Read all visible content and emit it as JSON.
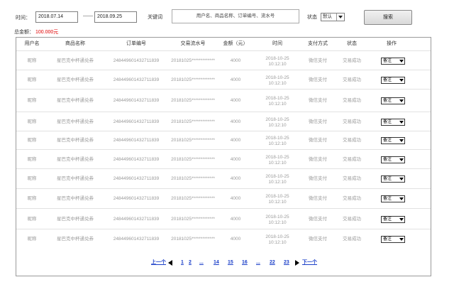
{
  "filters": {
    "time_label": "时间：",
    "start_date": "2018.07.14",
    "dash": "——",
    "end_date": "2018.09.25",
    "keyword_label": "关键词",
    "keyword_placeholder": "用户名、商品名称、订单编号、流水号",
    "status_label": "状态",
    "status_value": "默认",
    "search_button": "搜索"
  },
  "summary": {
    "total_label": "总金额：",
    "total_value": "100.000元",
    "total_color": "#e00000"
  },
  "table": {
    "headers": [
      "用户名",
      "商品名称",
      "订单编号",
      "交易流水号",
      "金额（元）",
      "时间",
      "支付方式",
      "状态",
      "操作"
    ],
    "rows": [
      {
        "user": "昵称",
        "product": "星巴克中杯通兑券",
        "order": "248449601432711839",
        "serial": "20181025*************",
        "amount": "4000",
        "date": "2018-10-25",
        "time": "10:12:10",
        "pay": "微信支付",
        "status": "交易成功",
        "op": "备注"
      },
      {
        "user": "昵称",
        "product": "星巴克中杯通兑券",
        "order": "248449601432711839",
        "serial": "20181025*************",
        "amount": "4000",
        "date": "2018-10-25",
        "time": "10:12:10",
        "pay": "微信支付",
        "status": "交易成功",
        "op": "备注"
      },
      {
        "user": "昵称",
        "product": "星巴克中杯通兑券",
        "order": "248449601432711839",
        "serial": "20181025*************",
        "amount": "4000",
        "date": "2018-10-25",
        "time": "10:12:10",
        "pay": "微信支付",
        "status": "交易成功",
        "op": "备注"
      },
      {
        "user": "昵称",
        "product": "星巴克中杯通兑券",
        "order": "248449601432711839",
        "serial": "20181025*************",
        "amount": "4000",
        "date": "2018-10-25",
        "time": "10:12:10",
        "pay": "微信支付",
        "status": "交易成功",
        "op": "备注"
      },
      {
        "user": "昵称",
        "product": "星巴克中杯通兑券",
        "order": "248449601432711839",
        "serial": "20181025*************",
        "amount": "4000",
        "date": "2018-10-25",
        "time": "10:12:10",
        "pay": "微信支付",
        "status": "交易成功",
        "op": "备注"
      },
      {
        "user": "昵称",
        "product": "星巴克中杯通兑券",
        "order": "248449601432711839",
        "serial": "20181025*************",
        "amount": "4000",
        "date": "2018-10-25",
        "time": "10:12:10",
        "pay": "微信支付",
        "status": "交易成功",
        "op": "备注"
      },
      {
        "user": "昵称",
        "product": "星巴克中杯通兑券",
        "order": "248449601432711839",
        "serial": "20181025*************",
        "amount": "4000",
        "date": "2018-10-25",
        "time": "10:12:10",
        "pay": "微信支付",
        "status": "交易成功",
        "op": "备注"
      },
      {
        "user": "昵称",
        "product": "星巴克中杯通兑券",
        "order": "248449601432711839",
        "serial": "20181025*************",
        "amount": "4000",
        "date": "2018-10-25",
        "time": "10:12:10",
        "pay": "微信支付",
        "status": "交易成功",
        "op": "备注"
      },
      {
        "user": "昵称",
        "product": "星巴克中杯通兑券",
        "order": "248449601432711839",
        "serial": "20181025*************",
        "amount": "4000",
        "date": "2018-10-25",
        "time": "10:12:10",
        "pay": "微信支付",
        "status": "交易成功",
        "op": "备注"
      },
      {
        "user": "昵称",
        "product": "星巴克中杯通兑券",
        "order": "248449601432711839",
        "serial": "20181025*************",
        "amount": "4000",
        "date": "2018-10-25",
        "time": "10:12:10",
        "pay": "微信支付",
        "status": "交易成功",
        "op": "备注"
      }
    ]
  },
  "pager": {
    "prev": "上一个",
    "pages": [
      "1",
      "2",
      "...",
      "14",
      "15",
      "16",
      "...",
      "22",
      "23"
    ],
    "next": "下一个"
  }
}
